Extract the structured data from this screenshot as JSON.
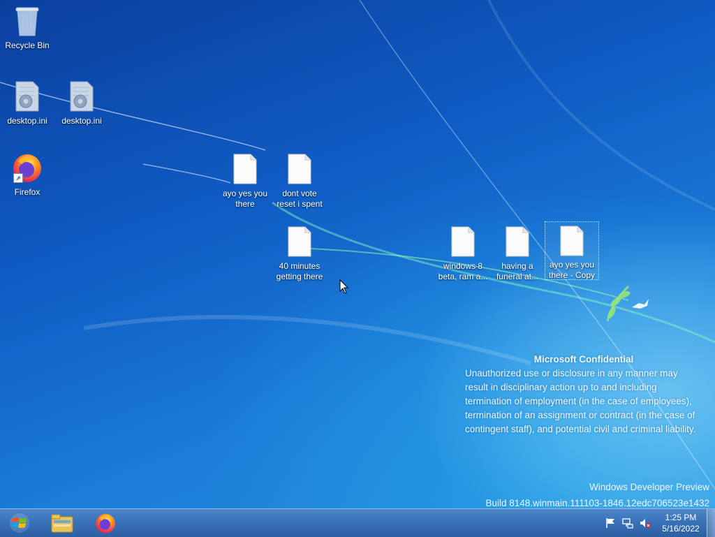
{
  "desktop": {
    "icons": [
      {
        "label": "Recycle Bin",
        "icon": "recycle-bin-icon"
      },
      {
        "label": "desktop.ini",
        "icon": "settings-file-icon"
      },
      {
        "label": "desktop.ini",
        "icon": "settings-file-icon"
      },
      {
        "label": "Firefox",
        "icon": "firefox-icon"
      },
      {
        "label": "ayo yes you there",
        "icon": "text-file-icon"
      },
      {
        "label": "dont vote reset i spent",
        "icon": "text-file-icon"
      },
      {
        "label": "40 minutes getting there",
        "icon": "text-file-icon"
      },
      {
        "label": "windows 8 beta, ram a...",
        "icon": "text-file-icon"
      },
      {
        "label": "having a funeral at...",
        "icon": "text-file-icon"
      },
      {
        "label": "ayo yes you there - Copy",
        "icon": "text-file-icon"
      }
    ]
  },
  "confidential": {
    "title": "Microsoft Confidential",
    "body": "Unauthorized use or disclosure in any manner may result in disciplinary action up to and including termination of employment (in the case of employees), termination of an assignment or contract (in the case of contingent staff), and potential civil and criminal liability."
  },
  "watermark": {
    "line1": "Windows Developer Preview",
    "line2": "Build 8148.winmain.111103-1846.12edc706523e1432"
  },
  "taskbar": {
    "pinned": [
      {
        "icon": "file-explorer-icon"
      },
      {
        "icon": "firefox-icon"
      }
    ],
    "tray": {
      "icons": [
        "action-center-flag-icon",
        "network-icon",
        "volume-muted-icon"
      ],
      "time": "1:25 PM",
      "date": "5/16/2022"
    }
  },
  "colors": {
    "taskbar": "#3a72b8",
    "desktop": "#1a7bd8"
  }
}
